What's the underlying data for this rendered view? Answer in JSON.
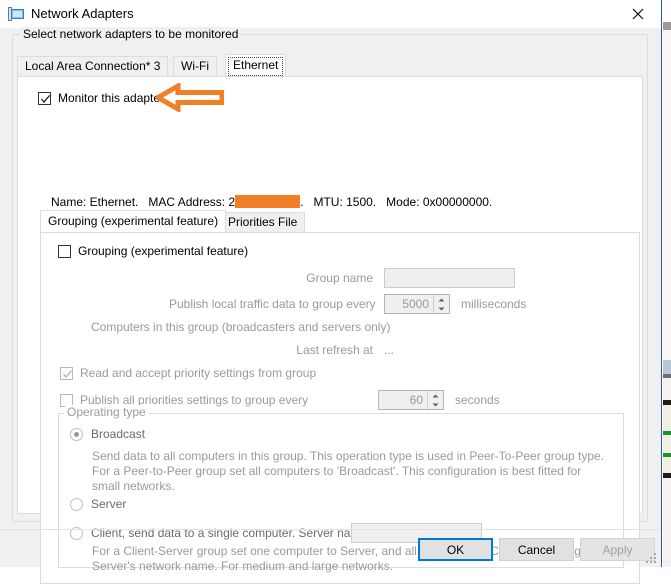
{
  "window": {
    "title": "Network Adapters",
    "icon": "network-adapter-icon",
    "close_icon": "close-icon",
    "accent_border": "#2a5db0"
  },
  "outer_group": {
    "label": "Select network adapters to be monitored"
  },
  "adapter_tabs": [
    {
      "label": "Local Area Connection* 3",
      "selected": false
    },
    {
      "label": "Wi-Fi",
      "selected": false
    },
    {
      "label": "Ethernet",
      "selected": true
    }
  ],
  "monitor": {
    "label": "Monitor this adapter",
    "checked": true
  },
  "annotation": {
    "shape": "left-arrow",
    "color": "#f07f28"
  },
  "adapter_info": {
    "name_label": "Name: Ethernet.",
    "mac_label": "MAC Address: 2",
    "mac_redacted": true,
    "mac_suffix": ".",
    "mtu_label": "MTU: 1500.",
    "mode_label": "Mode: 0x00000000.",
    "redaction_color": "#f07f28"
  },
  "inner_tabs": [
    {
      "label": "Grouping (experimental feature)",
      "selected": true
    },
    {
      "label": "Priorities File",
      "selected": false
    }
  ],
  "grouping": {
    "checkbox_label": "Grouping (experimental feature)",
    "checkbox_checked": false,
    "group_name_label": "Group name",
    "group_name_value": "",
    "group_name_placeholder": "",
    "publish_interval_label": "Publish local traffic data to group every",
    "publish_interval_value": "5000",
    "publish_interval_units": "milliseconds",
    "computers_label": "Computers in this group (broadcasters and servers only)",
    "last_refresh_label": "Last refresh at",
    "last_refresh_value": "..."
  },
  "priorities": {
    "read_accept_label": "Read and accept priority settings from group",
    "read_accept_checked": true,
    "publish_all_label": "Publish all priorities settings to group every",
    "publish_all_checked": false,
    "publish_all_value": "60",
    "publish_all_units": "seconds"
  },
  "operating_type": {
    "group_label": "Operating type",
    "options": [
      {
        "label": "Broadcast",
        "selected": true,
        "description": "Send data to all computers in this group. This operation type is used in Peer-To-Peer group type. For a Peer-to-Peer group set all computers to 'Broadcast'. This configuration is best fitted for small networks."
      },
      {
        "label": "Server",
        "selected": false,
        "description": ""
      },
      {
        "label": "Client, send data to a single computer. Server name:",
        "selected": false,
        "description": "For a Client-Server group set one computer to Server, and all the others to Client, specifying Server's network name. For medium and large networks.",
        "server_name_value": ""
      }
    ]
  },
  "buttons": {
    "ok": "OK",
    "cancel": "Cancel",
    "apply": "Apply",
    "apply_disabled": true,
    "ok_is_default": true
  }
}
